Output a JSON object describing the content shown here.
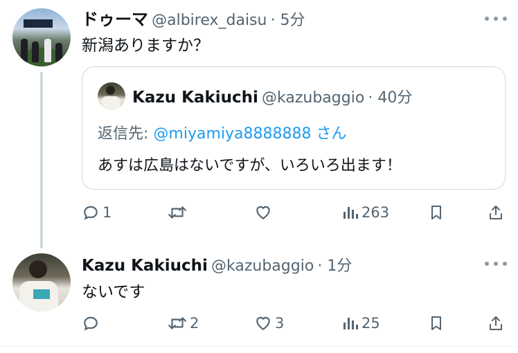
{
  "tweet1": {
    "name": "ドゥーマ",
    "handle": "@albirex_daisu",
    "time": "· 5分",
    "text": "新潟ありますか？"
  },
  "quote": {
    "name": "Kazu Kakiuchi",
    "handle": "@kazubaggio",
    "time": "· 40分",
    "reply_prefix": "返信先: ",
    "reply_mention": "@miyamiya8888888",
    "reply_suffix": " さん",
    "text": "あすは広島はないですが、いろいろ出ます！"
  },
  "tweet1_actions": {
    "replies": "1",
    "retweets": "",
    "likes": "",
    "views": "263"
  },
  "tweet2": {
    "name": "Kazu Kakiuchi",
    "handle": "@kazubaggio",
    "time": "· 1分",
    "text": "ないです"
  },
  "tweet2_actions": {
    "replies": "",
    "retweets": "2",
    "likes": "3",
    "views": "25"
  },
  "icons": {
    "reply": "reply-icon",
    "retweet": "retweet-icon",
    "like": "heart-icon",
    "views": "views-icon",
    "bookmark": "bookmark-icon",
    "share": "share-icon",
    "more": "more-icon"
  },
  "colors": {
    "text": "#0f1419",
    "secondary": "#536471",
    "link": "#1d9bf0",
    "border": "#cfd9de"
  }
}
